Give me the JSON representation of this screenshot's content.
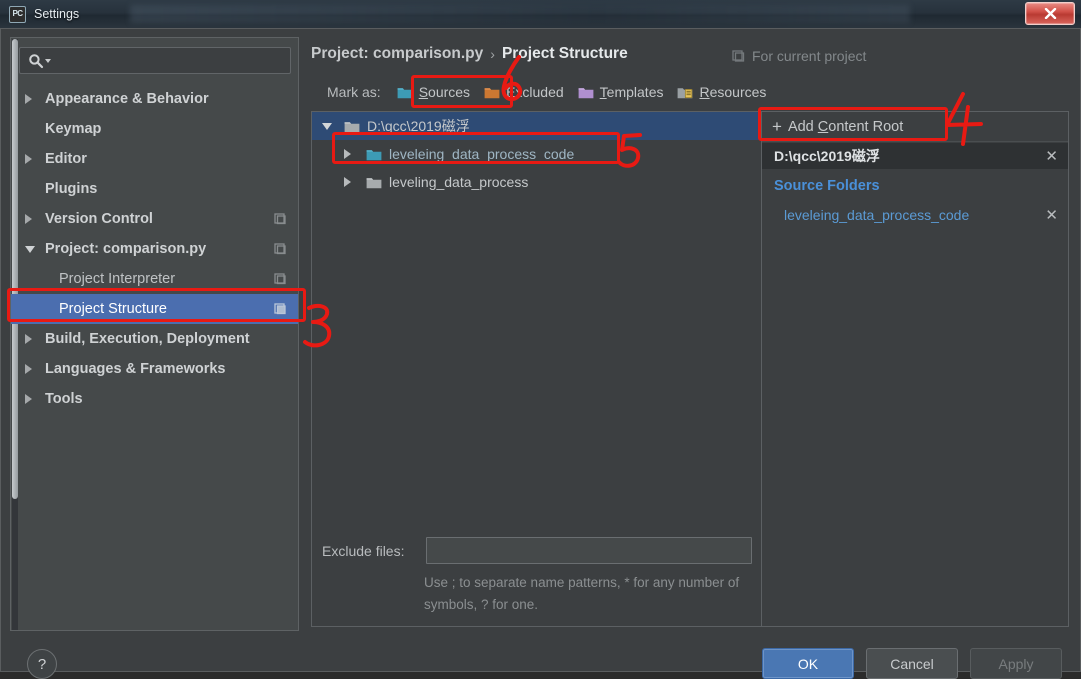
{
  "window": {
    "title": "Settings",
    "app_icon": "pycharm-icon",
    "close_label": "✕"
  },
  "sidebar": {
    "search": {
      "value": "",
      "placeholder": "",
      "icon": "search-icon"
    },
    "items": [
      {
        "label": "Appearance & Behavior",
        "twisty": "right",
        "level": 0,
        "badge": false,
        "selected": false
      },
      {
        "label": "Keymap",
        "twisty": "none",
        "level": 0,
        "badge": false,
        "selected": false
      },
      {
        "label": "Editor",
        "twisty": "right",
        "level": 0,
        "badge": false,
        "selected": false
      },
      {
        "label": "Plugins",
        "twisty": "none",
        "level": 0,
        "badge": false,
        "selected": false
      },
      {
        "label": "Version Control",
        "twisty": "right",
        "level": 0,
        "badge": true,
        "selected": false
      },
      {
        "label": "Project: comparison.py",
        "twisty": "down",
        "level": 0,
        "badge": true,
        "selected": false
      },
      {
        "label": "Project Interpreter",
        "twisty": "none",
        "level": 1,
        "badge": true,
        "selected": false
      },
      {
        "label": "Project Structure",
        "twisty": "none",
        "level": 1,
        "badge": true,
        "selected": true
      },
      {
        "label": "Build, Execution, Deployment",
        "twisty": "right",
        "level": 0,
        "badge": false,
        "selected": false
      },
      {
        "label": "Languages & Frameworks",
        "twisty": "right",
        "level": 0,
        "badge": false,
        "selected": false
      },
      {
        "label": "Tools",
        "twisty": "right",
        "level": 0,
        "badge": false,
        "selected": false
      }
    ]
  },
  "content": {
    "breadcrumb": {
      "parent": "Project: comparison.py",
      "separator": "›",
      "current": "Project Structure"
    },
    "scope_label": "For current project",
    "mark_as": {
      "label": "Mark as:",
      "options": [
        {
          "label": "Sources",
          "mnemonic": "S",
          "color": "#3d9bb5",
          "icon": "folder-sources-icon"
        },
        {
          "label": "Excluded",
          "mnemonic": "E",
          "color": "#cc7832",
          "icon": "folder-excluded-icon"
        },
        {
          "label": "Templates",
          "mnemonic": "T",
          "color": "#b08fd0",
          "icon": "folder-templates-icon"
        },
        {
          "label": "Resources",
          "mnemonic": "R",
          "color": "#a0a4a6",
          "icon": "folder-resources-icon"
        }
      ]
    },
    "tree": [
      {
        "label": "D:\\qcc\\2019磁浮",
        "twisty": "down",
        "level": 0,
        "folder_color": "#a7abad",
        "selected": true,
        "source": false
      },
      {
        "label": "leveleing_data_process_code",
        "twisty": "right",
        "level": 1,
        "folder_color": "#3d9bb5",
        "selected": false,
        "source": true
      },
      {
        "label": "leveling_data_process",
        "twisty": "right",
        "level": 1,
        "folder_color": "#a7abad",
        "selected": false,
        "source": false
      }
    ],
    "exclude_files": {
      "label": "Exclude files:",
      "value": "",
      "placeholder": "",
      "hint": "Use ; to separate name patterns, * for any number of symbols, ? for one."
    },
    "right_panel": {
      "add_content_root": {
        "plus": "+",
        "pre": "Add ",
        "mnemonic": "C",
        "post": "ontent Root"
      },
      "content_root": {
        "label": "D:\\qcc\\2019磁浮",
        "remove": "✕"
      },
      "source_folders_header": "Source Folders",
      "source_folders": [
        {
          "label": "leveleing_data_process_code",
          "remove": "✕"
        }
      ]
    }
  },
  "footer": {
    "help_label": "?",
    "ok_label": "OK",
    "cancel_label": "Cancel",
    "apply_label": "Apply"
  },
  "annotations": {
    "numbers": [
      "3",
      "4",
      "5",
      "6"
    ],
    "color": "#e81a13"
  }
}
